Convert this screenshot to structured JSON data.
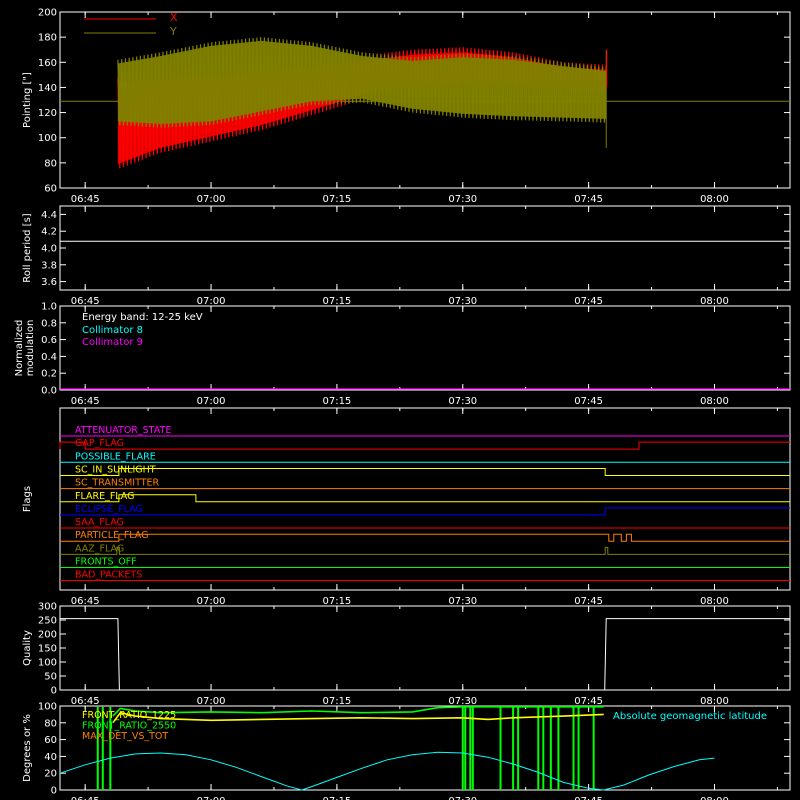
{
  "chart_data": [
    {
      "type": "line",
      "ylabel": "Pointing [\"]",
      "ylim": [
        60,
        200
      ],
      "yticks": [
        60,
        80,
        100,
        120,
        140,
        160,
        180,
        200
      ],
      "xticks": [
        "06:45",
        "07:00",
        "07:15",
        "07:30",
        "07:45",
        "08:00"
      ],
      "legend": [
        "X",
        "Y"
      ],
      "legend_placement": "top-left",
      "colors": [
        "#ff0000",
        "#808000"
      ],
      "series": [
        {
          "name": "X",
          "color": "#ff0000",
          "upper": [
            [
              6.815,
              148
            ],
            [
              6.9,
              150
            ],
            [
              7.0,
              152
            ],
            [
              7.1,
              156
            ],
            [
              7.2,
              160
            ],
            [
              7.3,
              165
            ],
            [
              7.4,
              170
            ],
            [
              7.5,
              172
            ],
            [
              7.6,
              168
            ],
            [
              7.7,
              160
            ],
            [
              7.785,
              158
            ]
          ],
          "lower": [
            [
              6.815,
              75
            ],
            [
              6.9,
              88
            ],
            [
              7.0,
              97
            ],
            [
              7.1,
              106
            ],
            [
              7.2,
              118
            ],
            [
              7.3,
              130
            ],
            [
              7.4,
              138
            ],
            [
              7.5,
              140
            ],
            [
              7.6,
              140
            ],
            [
              7.7,
              138
            ],
            [
              7.785,
              137
            ]
          ]
        },
        {
          "name": "Y",
          "color": "#808000",
          "upper": [
            [
              6.815,
              162
            ],
            [
              6.9,
              168
            ],
            [
              7.0,
              176
            ],
            [
              7.1,
              180
            ],
            [
              7.2,
              176
            ],
            [
              7.3,
              168
            ],
            [
              7.4,
              164
            ],
            [
              7.5,
              167
            ],
            [
              7.6,
              165
            ],
            [
              7.7,
              160
            ],
            [
              7.785,
              156
            ]
          ],
          "lower": [
            [
              6.815,
              110
            ],
            [
              6.9,
              108
            ],
            [
              7.0,
              110
            ],
            [
              7.1,
              118
            ],
            [
              7.2,
              126
            ],
            [
              7.3,
              128
            ],
            [
              7.4,
              120
            ],
            [
              7.5,
              116
            ],
            [
              7.6,
              114
            ],
            [
              7.7,
              113
            ],
            [
              7.785,
              112
            ]
          ]
        }
      ],
      "baseline": 129
    },
    {
      "type": "line",
      "ylabel": "Roll period [s]",
      "ylim": [
        3.5,
        4.5
      ],
      "yticks": [
        3.6,
        3.8,
        4.0,
        4.2,
        4.4
      ],
      "xticks": [
        "06:45",
        "07:00",
        "07:15",
        "07:30",
        "07:45",
        "08:00"
      ],
      "series": [
        {
          "color": "#ffffff",
          "value": 4.08
        }
      ]
    },
    {
      "type": "line",
      "ylabel": "Normalized modulation",
      "ylim": [
        0.0,
        1.0
      ],
      "yticks": [
        0.0,
        0.2,
        0.4,
        0.6,
        0.8,
        1.0
      ],
      "xticks": [
        "06:45",
        "07:00",
        "07:15",
        "07:30",
        "07:45",
        "08:00"
      ],
      "annotation": "Energy band: 12-25 keV",
      "legend": [
        {
          "name": "Collimator 8",
          "color": "#00ffff"
        },
        {
          "name": "Collimator 9",
          "color": "#ff00ff"
        }
      ],
      "series": [
        {
          "name": "Collimator 9",
          "color": "#ff00ff",
          "value": 0.0
        }
      ]
    },
    {
      "type": "line",
      "ylabel": "Flags",
      "xticks": [
        "06:45",
        "07:00",
        "07:15",
        "07:30",
        "07:45",
        "08:00"
      ],
      "flags": [
        {
          "name": "ATTENUATOR_STATE",
          "color": "#ff00ff",
          "steps": []
        },
        {
          "name": "GAP_FLAG",
          "color": "#ff0000",
          "steps": [
            [
              6.7,
              1
            ],
            [
              6.75,
              0
            ],
            [
              7.85,
              1
            ]
          ]
        },
        {
          "name": "POSSIBLE_FLARE",
          "color": "#00ffff",
          "steps": []
        },
        {
          "name": "SC_IN_SUNLIGHT",
          "color": "#ffff00",
          "steps": [
            [
              6.817,
              1
            ],
            [
              7.783,
              0
            ]
          ]
        },
        {
          "name": "SC_TRANSMITTER",
          "color": "#ff8000",
          "steps": []
        },
        {
          "name": "FLARE_FLAG",
          "color": "#ffff00",
          "steps": [
            [
              6.817,
              1
            ],
            [
              6.97,
              0
            ]
          ]
        },
        {
          "name": "ECLIPSE_FLAG",
          "color": "#0000ff",
          "steps": [
            [
              6.817,
              0
            ],
            [
              7.783,
              1
            ]
          ]
        },
        {
          "name": "SAA_FLAG",
          "color": "#ff0000",
          "steps": []
        },
        {
          "name": "PARTICLE_FLAG",
          "color": "#ff8000",
          "steps": [
            [
              6.817,
              1
            ],
            [
              7.79,
              0
            ],
            [
              7.8,
              1
            ],
            [
              7.815,
              0
            ],
            [
              7.825,
              1
            ],
            [
              7.835,
              0
            ]
          ]
        },
        {
          "name": "AAZ_FLAG",
          "color": "#808000",
          "steps": [
            [
              6.813,
              1
            ],
            [
              6.818,
              0
            ],
            [
              7.783,
              1
            ],
            [
              7.788,
              0
            ]
          ]
        },
        {
          "name": "FRONTS_OFF",
          "color": "#00ff00",
          "steps": []
        },
        {
          "name": "BAD_PACKETS",
          "color": "#ff0000",
          "steps": []
        }
      ]
    },
    {
      "type": "line",
      "ylabel": "Quality",
      "ylim": [
        0,
        300
      ],
      "yticks": [
        0,
        50,
        100,
        150,
        200,
        250,
        300
      ],
      "xticks": [
        "06:45",
        "07:00",
        "07:15",
        "07:30",
        "07:45",
        "08:00"
      ],
      "series": [
        {
          "color": "#ffffff",
          "points": [
            [
              6.7,
              255
            ],
            [
              6.815,
              255
            ],
            [
              6.818,
              0
            ],
            [
              7.782,
              0
            ],
            [
              7.785,
              255
            ],
            [
              8.15,
              255
            ]
          ]
        }
      ]
    },
    {
      "type": "line",
      "ylabel": "Degrees or %",
      "ylim": [
        0,
        100
      ],
      "yticks": [
        0,
        20,
        40,
        60,
        80,
        100
      ],
      "xticks": [
        "06:45",
        "07:00",
        "07:15",
        "07:30",
        "07:45",
        "08:00"
      ],
      "legend": [
        {
          "name": "FRONT_RATIO_1225",
          "color": "#ffff00"
        },
        {
          "name": "FRONT_RATIO_2550",
          "color": "#00ff00"
        },
        {
          "name": "MAX_DET_VS_TOT",
          "color": "#ff8000"
        }
      ],
      "annotation_right": {
        "text": "Absolute geomagnetic latitude",
        "color": "#00ffff"
      },
      "series": [
        {
          "name": "Absolute geomagnetic latitude",
          "color": "#00ffff",
          "points": [
            [
              6.7,
              20
            ],
            [
              6.75,
              30
            ],
            [
              6.8,
              38
            ],
            [
              6.85,
              43
            ],
            [
              6.9,
              44
            ],
            [
              6.95,
              42
            ],
            [
              7.0,
              36
            ],
            [
              7.05,
              27
            ],
            [
              7.1,
              16
            ],
            [
              7.15,
              5
            ],
            [
              7.18,
              0
            ],
            [
              7.2,
              4
            ],
            [
              7.25,
              15
            ],
            [
              7.3,
              26
            ],
            [
              7.35,
              36
            ],
            [
              7.4,
              42
            ],
            [
              7.45,
              45
            ],
            [
              7.5,
              44
            ],
            [
              7.55,
              39
            ],
            [
              7.6,
              31
            ],
            [
              7.65,
              21
            ],
            [
              7.7,
              9
            ],
            [
              7.75,
              2
            ],
            [
              7.78,
              0
            ],
            [
              7.82,
              6
            ],
            [
              7.87,
              18
            ],
            [
              7.92,
              28
            ],
            [
              7.97,
              36
            ],
            [
              8.0,
              38
            ]
          ]
        },
        {
          "name": "FRONT_RATIO_1225",
          "color": "#ffff00",
          "points": [
            [
              6.805,
              80
            ],
            [
              6.82,
              92
            ],
            [
              6.85,
              88
            ],
            [
              6.9,
              85
            ],
            [
              7.0,
              83
            ],
            [
              7.1,
              84
            ],
            [
              7.2,
              85
            ],
            [
              7.3,
              86
            ],
            [
              7.4,
              85
            ],
            [
              7.5,
              86
            ],
            [
              7.55,
              84
            ],
            [
              7.6,
              86
            ],
            [
              7.7,
              88
            ],
            [
              7.78,
              90
            ]
          ]
        },
        {
          "name": "FRONT_RATIO_2550",
          "color": "#00ff00",
          "points": [
            [
              6.805,
              88
            ],
            [
              6.82,
              97
            ],
            [
              6.85,
              94
            ],
            [
              6.9,
              92
            ],
            [
              7.0,
              93
            ],
            [
              7.1,
              92
            ],
            [
              7.2,
              94
            ],
            [
              7.3,
              92
            ],
            [
              7.4,
              93
            ],
            [
              7.45,
              98
            ],
            [
              7.5,
              99
            ],
            [
              7.6,
              99
            ],
            [
              7.7,
              99
            ],
            [
              7.78,
              99
            ]
          ]
        }
      ],
      "spikes_x": [
        6.775,
        6.785,
        6.8,
        7.5,
        7.505,
        7.515,
        7.52,
        7.575,
        7.6,
        7.61,
        7.65,
        7.66,
        7.675,
        7.69,
        7.72,
        7.73,
        7.76
      ]
    }
  ]
}
